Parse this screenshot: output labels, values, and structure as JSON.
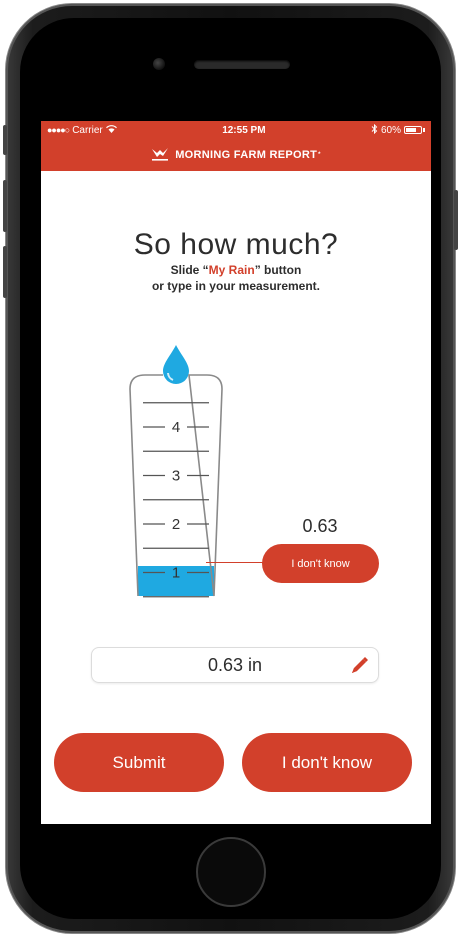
{
  "status_bar": {
    "signal": "●●●●○",
    "carrier": "Carrier",
    "time": "12:55 PM",
    "battery": "60%"
  },
  "app_bar": {
    "brand": "MORNING FARM REPORT",
    "trademark": "*"
  },
  "main": {
    "title": "So how much?",
    "subtitle_prefix": "Slide “",
    "subtitle_highlight": "My Rain",
    "subtitle_suffix": "” button",
    "subtitle_line2": "or type in your measurement."
  },
  "gauge": {
    "ticks": [
      "4",
      "3",
      "2",
      "1"
    ],
    "fill_fraction": 0.1575,
    "fill_value": 0.63,
    "max_value": 4,
    "fill_color": "#1fa9e1"
  },
  "slider": {
    "value": "0.63",
    "button_label": "I don't know"
  },
  "measurement": {
    "value": "0.63 in"
  },
  "actions": {
    "submit_label": "Submit",
    "dont_know_label": "I don't know"
  },
  "colors": {
    "accent": "#d2402b",
    "water": "#1fa9e1",
    "text": "#2d2d2d"
  }
}
